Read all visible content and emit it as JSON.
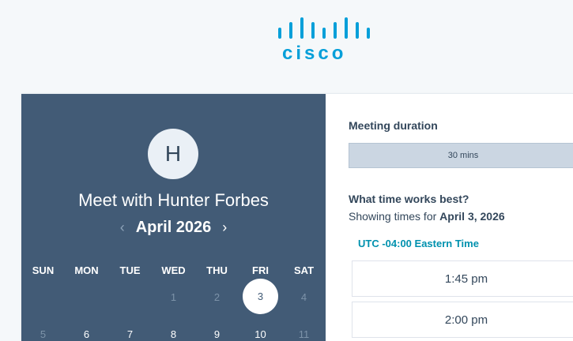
{
  "logo": {
    "text": "cisco",
    "color": "#049fd9"
  },
  "host": {
    "initial": "H",
    "title": "Meet with Hunter Forbes"
  },
  "calendar": {
    "month": "April 2026",
    "prev_icon": "chevron-left-icon",
    "next_icon": "chevron-right-icon",
    "weekdays": [
      "SUN",
      "MON",
      "TUE",
      "WED",
      "THU",
      "FRI",
      "SAT"
    ],
    "week1": [
      "1",
      "2",
      "3",
      "4"
    ],
    "week2": [
      "5",
      "6",
      "7",
      "8",
      "9",
      "10",
      "11"
    ],
    "selected_day": "3"
  },
  "panel": {
    "duration_label": "Meeting duration",
    "duration_value": "30 mins",
    "question": "What time works best?",
    "showing_prefix": "Showing times for ",
    "showing_date": "April 3, 2026",
    "timezone": "UTC -04:00 Eastern Time",
    "slots": [
      "1:45 pm",
      "2:00 pm"
    ]
  },
  "colors": {
    "left_bg": "#425b76",
    "accent": "#0091ae"
  }
}
